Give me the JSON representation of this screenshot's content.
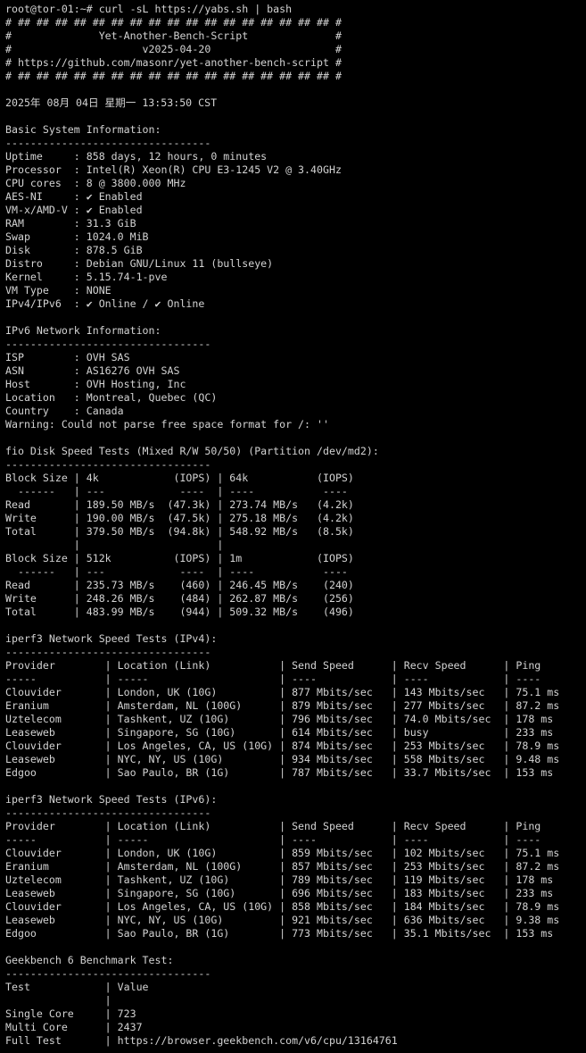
{
  "terminal": {
    "background": "#000000",
    "foreground": "#d3d3d3",
    "lines": [
      "root@tor-01:~# curl -sL https://yabs.sh | bash",
      "# ## ## ## ## ## ## ## ## ## ## ## ## ## ## ## ## ## #",
      "#              Yet-Another-Bench-Script              #",
      "#                     v2025-04-20                    #",
      "# https://github.com/masonr/yet-another-bench-script #",
      "# ## ## ## ## ## ## ## ## ## ## ## ## ## ## ## ## ## #",
      "",
      "2025年 08月 04日 星期一 13:53:50 CST",
      "",
      "Basic System Information:",
      "---------------------------------",
      "Uptime     : 858 days, 12 hours, 0 minutes",
      "Processor  : Intel(R) Xeon(R) CPU E3-1245 V2 @ 3.40GHz",
      "CPU cores  : 8 @ 3800.000 MHz",
      "AES-NI     : ✔ Enabled",
      "VM-x/AMD-V : ✔ Enabled",
      "RAM        : 31.3 GiB",
      "Swap       : 1024.0 MiB",
      "Disk       : 878.5 GiB",
      "Distro     : Debian GNU/Linux 11 (bullseye)",
      "Kernel     : 5.15.74-1-pve",
      "VM Type    : NONE",
      "IPv4/IPv6  : ✔ Online / ✔ Online",
      "",
      "IPv6 Network Information:",
      "---------------------------------",
      "ISP        : OVH SAS",
      "ASN        : AS16276 OVH SAS",
      "Host       : OVH Hosting, Inc",
      "Location   : Montreal, Quebec (QC)",
      "Country    : Canada",
      "Warning: Could not parse free space format for /: ''",
      "",
      "fio Disk Speed Tests (Mixed R/W 50/50) (Partition /dev/md2):",
      "---------------------------------",
      "Block Size | 4k            (IOPS) | 64k           (IOPS)",
      "  ------   | ---            ----  | ----           ----",
      "Read       | 189.50 MB/s  (47.3k) | 273.74 MB/s   (4.2k)",
      "Write      | 190.00 MB/s  (47.5k) | 275.18 MB/s   (4.2k)",
      "Total      | 379.50 MB/s  (94.8k) | 548.92 MB/s   (8.5k)",
      "           |                      |",
      "Block Size | 512k          (IOPS) | 1m            (IOPS)",
      "  ------   | ---            ----  | ----           ----",
      "Read       | 235.73 MB/s    (460) | 246.45 MB/s    (240)",
      "Write      | 248.26 MB/s    (484) | 262.87 MB/s    (256)",
      "Total      | 483.99 MB/s    (944) | 509.32 MB/s    (496)",
      "",
      "iperf3 Network Speed Tests (IPv4):",
      "---------------------------------",
      "Provider        | Location (Link)           | Send Speed      | Recv Speed      | Ping",
      "-----           | -----                     | ----            | ----            | ----",
      "Clouvider       | London, UK (10G)          | 877 Mbits/sec   | 143 Mbits/sec   | 75.1 ms",
      "Eranium         | Amsterdam, NL (100G)      | 879 Mbits/sec   | 277 Mbits/sec   | 87.2 ms",
      "Uztelecom       | Tashkent, UZ (10G)        | 796 Mbits/sec   | 74.0 Mbits/sec  | 178 ms",
      "Leaseweb        | Singapore, SG (10G)       | 614 Mbits/sec   | busy            | 233 ms",
      "Clouvider       | Los Angeles, CA, US (10G) | 874 Mbits/sec   | 253 Mbits/sec   | 78.9 ms",
      "Leaseweb        | NYC, NY, US (10G)         | 934 Mbits/sec   | 558 Mbits/sec   | 9.48 ms",
      "Edgoo           | Sao Paulo, BR (1G)        | 787 Mbits/sec   | 33.7 Mbits/sec  | 153 ms",
      "",
      "iperf3 Network Speed Tests (IPv6):",
      "---------------------------------",
      "Provider        | Location (Link)           | Send Speed      | Recv Speed      | Ping",
      "-----           | -----                     | ----            | ----            | ----",
      "Clouvider       | London, UK (10G)          | 859 Mbits/sec   | 102 Mbits/sec   | 75.1 ms",
      "Eranium         | Amsterdam, NL (100G)      | 857 Mbits/sec   | 253 Mbits/sec   | 87.2 ms",
      "Uztelecom       | Tashkent, UZ (10G)        | 789 Mbits/sec   | 119 Mbits/sec   | 178 ms",
      "Leaseweb        | Singapore, SG (10G)       | 696 Mbits/sec   | 183 Mbits/sec   | 233 ms",
      "Clouvider       | Los Angeles, CA, US (10G) | 858 Mbits/sec   | 184 Mbits/sec   | 78.9 ms",
      "Leaseweb        | NYC, NY, US (10G)         | 921 Mbits/sec   | 636 Mbits/sec   | 9.38 ms",
      "Edgoo           | Sao Paulo, BR (1G)        | 773 Mbits/sec   | 35.1 Mbits/sec  | 153 ms",
      "",
      "Geekbench 6 Benchmark Test:",
      "---------------------------------",
      "Test            | Value",
      "                |",
      "Single Core     | 723",
      "Multi Core      | 2437",
      "Full Test       | https://browser.geekbench.com/v6/cpu/13164761"
    ]
  }
}
